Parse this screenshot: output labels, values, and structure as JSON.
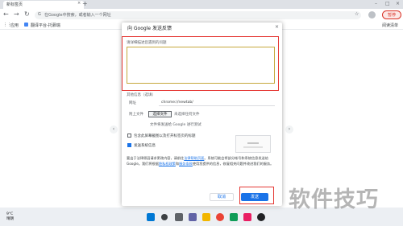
{
  "browser": {
    "tab_title": "新标签页",
    "tab_close": "×",
    "new_tab": "+",
    "omnibox_placeholder": "在Google中搜索，或者输入一个网址",
    "pause_label": "暂停",
    "bookmarks": [
      "应用",
      "翻译平台-托慕瑞"
    ],
    "reading_list": "阅读清单"
  },
  "dialog": {
    "title": "向 Google 发送反馈",
    "close": "×",
    "feedback_label": "请详细描述您遇到的问题",
    "feedback_value": "",
    "additional_info_label": "其他信息（选填）",
    "url_label": "网址",
    "url_value": "chrome://newtab/",
    "attach_label": "附上文件",
    "choose_file_button": "选择文件",
    "no_file_text": "未选择任何文件",
    "file_hint": "文件将发送给 Google 进行测试",
    "checkbox_screenshot": "包含此屏幕截图以及打开标签页的标题",
    "checkbox_screenshot_checked": false,
    "checkbox_system": "发送系统信息",
    "checkbox_system_checked": true,
    "privacy_text_1": "要出于法律原因请求更改内容，请前往",
    "privacy_link_1": "法律帮助页面",
    "privacy_text_2": "。系统可能会将部分帐号和系统信息发送给 Google。我们将根据",
    "privacy_link_2": "隐私权政策",
    "privacy_text_3": "和",
    "privacy_link_3": "服务条款",
    "privacy_text_4": "使用您提供的信息，修复相关问题并改进我们的服务。",
    "cancel_button": "取消",
    "send_button": "发送"
  },
  "taskbar": {
    "temperature": "9°C",
    "weather": "晴朗"
  },
  "watermark": "软件技巧",
  "colors": {
    "accent": "#1a73e8",
    "highlight_box": "#e53935",
    "textarea_border": "#c6a83c"
  }
}
